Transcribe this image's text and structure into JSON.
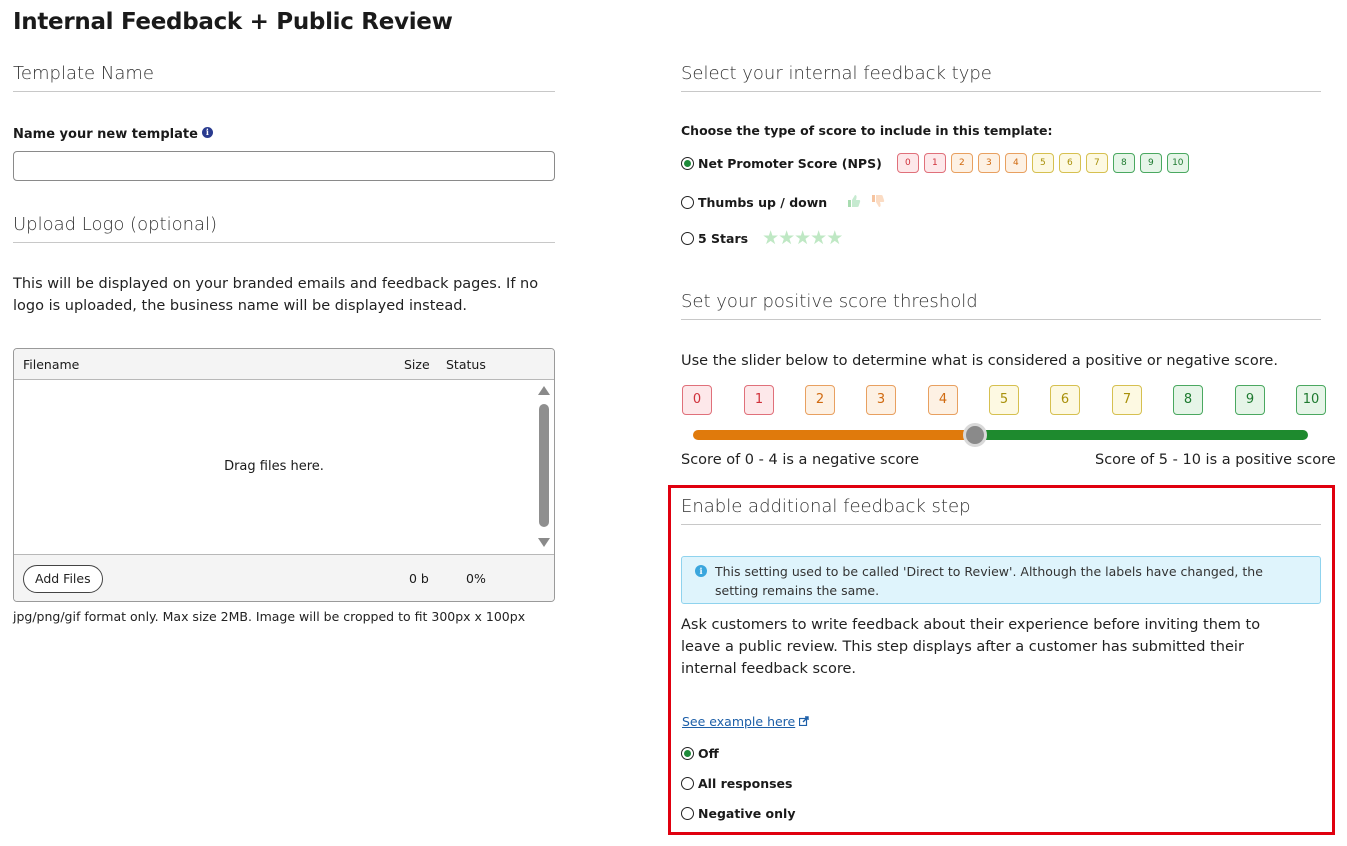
{
  "page": {
    "title": "Internal Feedback + Public Review"
  },
  "template_name": {
    "heading": "Template Name",
    "field_label": "Name your new template",
    "info_icon": "info-icon",
    "input_value": "",
    "input_placeholder": ""
  },
  "upload_logo": {
    "heading": "Upload Logo (optional)",
    "description": "This will be displayed on your branded emails and feedback pages. If no logo is uploaded, the business name will be displayed instead.",
    "columns": [
      "Filename",
      "Size",
      "Status"
    ],
    "drop_text": "Drag files here.",
    "add_files_label": "Add Files",
    "total_size": "0 b",
    "total_status": "0%",
    "note": "jpg/png/gif format only. Max size 2MB. Image will be cropped to fit 300px x 100px"
  },
  "feedback_type": {
    "heading": "Select your internal feedback type",
    "prompt": "Choose the type of score to include in this template:",
    "options": [
      {
        "label": "Net Promoter Score (NPS)",
        "checked": true
      },
      {
        "label": "Thumbs up / down",
        "checked": false
      },
      {
        "label": "5 Stars",
        "checked": false
      }
    ],
    "nps_scale": [
      "0",
      "1",
      "2",
      "3",
      "4",
      "5",
      "6",
      "7",
      "8",
      "9",
      "10"
    ],
    "stars": "★★★★★",
    "thumbs_up_icon": "thumbs-up-icon",
    "thumbs_down_icon": "thumbs-down-icon"
  },
  "threshold": {
    "heading": "Set your positive score threshold",
    "description": "Use the slider below to determine what is considered a positive or negative score.",
    "scale": [
      "0",
      "1",
      "2",
      "3",
      "4",
      "5",
      "6",
      "7",
      "8",
      "9",
      "10"
    ],
    "slider_value": 5,
    "negative_caption": "Score of 0 - 4 is a negative score",
    "positive_caption": "Score of 5 - 10 is a positive score"
  },
  "additional_step": {
    "heading": "Enable additional feedback step",
    "banner": "This setting used to be called 'Direct to Review'. Although the labels have changed, the setting remains the same.",
    "description": "Ask customers to write feedback about their experience before inviting them to leave a public review. This step displays after a customer has submitted their internal feedback score.",
    "example_link": "See example here",
    "options": [
      {
        "label": "Off",
        "checked": true
      },
      {
        "label": "All responses",
        "checked": false
      },
      {
        "label": "Negative only",
        "checked": false
      }
    ]
  },
  "colors": {
    "negative": "#e07a0c",
    "positive": "#1e8a2e",
    "highlight_frame": "#e0000f",
    "link": "#1d5fa8",
    "banner_bg": "#dff4fc"
  }
}
